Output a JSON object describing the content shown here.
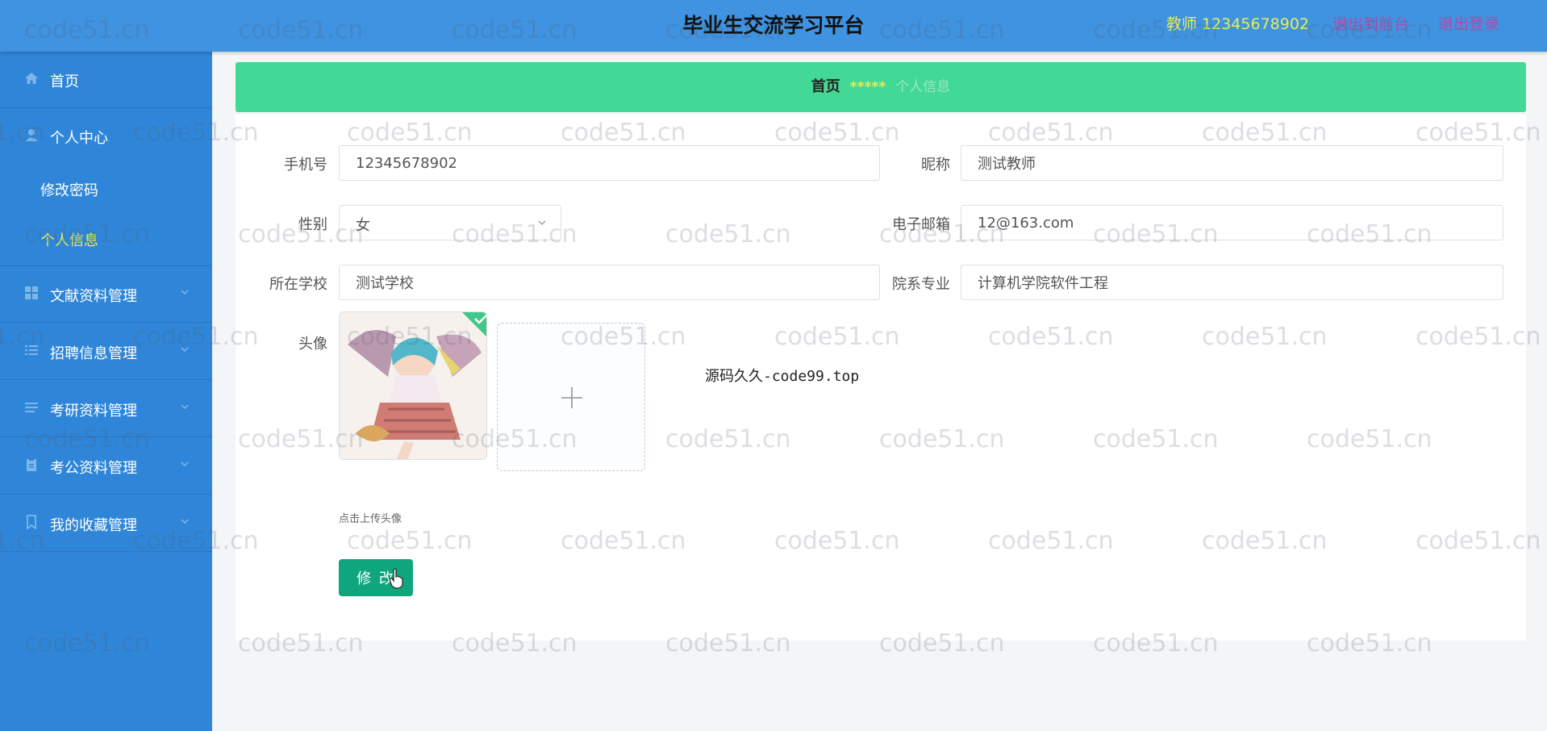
{
  "header": {
    "title": "毕业生交流学习平台",
    "user_label": "教师 12345678902",
    "back_label": "退出到前台",
    "logout_label": "退出登录"
  },
  "sidebar": {
    "items": [
      {
        "label": "首页",
        "icon": "home-icon"
      },
      {
        "label": "个人中心",
        "icon": "user-icon"
      },
      {
        "label": "文献资料管理",
        "icon": "grid-icon"
      },
      {
        "label": "招聘信息管理",
        "icon": "list-icon"
      },
      {
        "label": "考研资料管理",
        "icon": "lines-icon"
      },
      {
        "label": "考公资料管理",
        "icon": "clipboard-icon"
      },
      {
        "label": "我的收藏管理",
        "icon": "bookmark-icon"
      }
    ],
    "subitems": [
      {
        "label": "修改密码"
      },
      {
        "label": "个人信息"
      }
    ]
  },
  "breadcrumb": {
    "home": "首页",
    "separator": "*****",
    "current": "个人信息"
  },
  "form": {
    "phone": {
      "label": "手机号",
      "value": "12345678902"
    },
    "nickname": {
      "label": "昵称",
      "value": "测试教师"
    },
    "gender": {
      "label": "性别",
      "value": "女"
    },
    "email": {
      "label": "电子邮箱",
      "value": "12@163.com"
    },
    "school": {
      "label": "所在学校",
      "value": "测试学校"
    },
    "major": {
      "label": "院系专业",
      "value": "计算机学院软件工程"
    },
    "avatar": {
      "label": "头像",
      "hint": "点击上传头像"
    },
    "submit_label": "修 改"
  },
  "overlay_text": "源码久久-code99.top",
  "watermark_text": "code51.cn",
  "colors": {
    "header_bg": "#3f93e0",
    "sidebar_bg": "#2f86d8",
    "breadcrumb_bg": "#42d895",
    "active_yellow": "#e8ec5a",
    "submit_green": "#0fa67d",
    "link_purple": "#b04aa8"
  }
}
